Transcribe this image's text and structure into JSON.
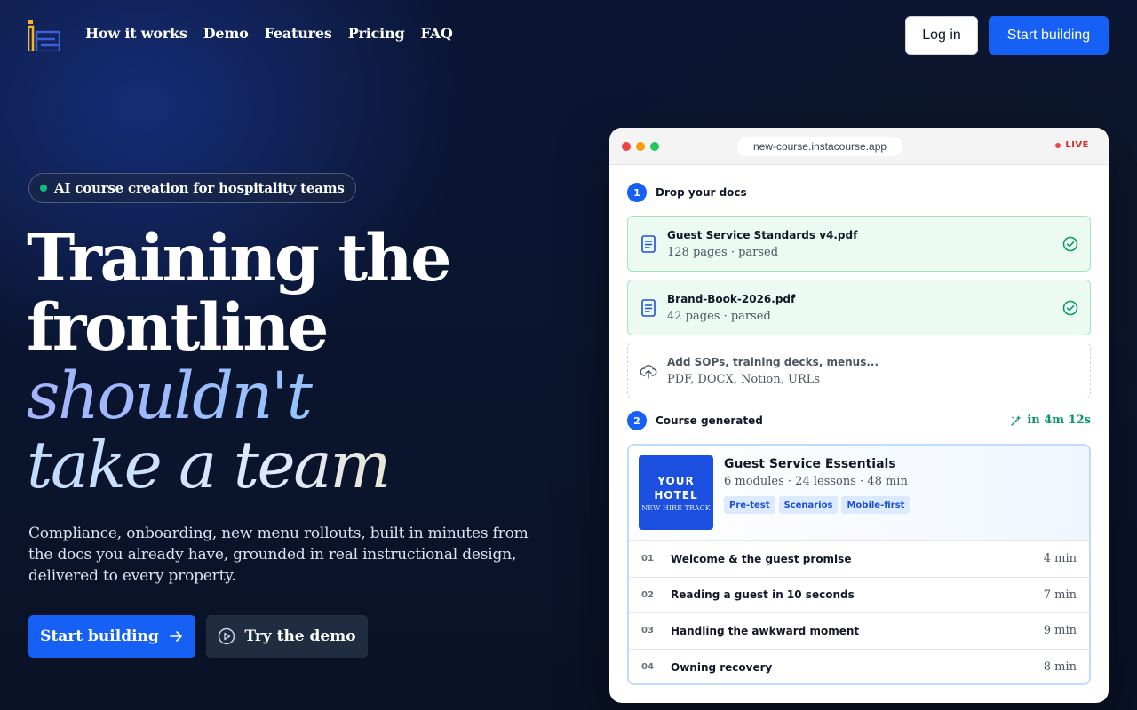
{
  "nav": {
    "logo_icon": "instacourse-logo-icon",
    "links": [
      "How it works",
      "Demo",
      "Features",
      "Pricing",
      "FAQ"
    ],
    "login_label": "Log in",
    "start_label": "Start building"
  },
  "hero": {
    "pill": "AI course creation for hospitality teams",
    "headline": {
      "line1": "Training the",
      "line2": "frontline",
      "line3": "shouldn't",
      "line4": "take a team"
    },
    "subcopy": "Compliance, onboarding, new menu rollouts, built in minutes from the docs you already have, grounded in real instructional design, delivered to every property.",
    "cta_primary": "Start building",
    "cta_secondary": "Try the demo"
  },
  "demo": {
    "url": "new-course.instacourse.app",
    "live": "LIVE",
    "step1": {
      "num": "1",
      "label": "Drop your docs"
    },
    "files": [
      {
        "title": "Guest Service Standards v4.pdf",
        "meta": "128 pages · parsed"
      },
      {
        "title": "Brand-Book-2026.pdf",
        "meta": "42 pages · parsed"
      }
    ],
    "upload": {
      "title": "Add SOPs, training decks, menus...",
      "meta": "PDF, DOCX, Notion, URLs"
    },
    "step2": {
      "num": "2",
      "label": "Course generated"
    },
    "timer": "in 4m 12s",
    "course": {
      "thumb_line1": "YOUR",
      "thumb_line2": "HOTEL",
      "thumb_line3": "NEW HIRE TRACK",
      "title": "Guest Service Essentials",
      "meta": "6 modules · 24 lessons · 48 min",
      "tags": [
        "Pre-test",
        "Scenarios",
        "Mobile-first"
      ],
      "lessons": [
        {
          "num": "01",
          "title": "Welcome & the guest promise",
          "time": "4 min"
        },
        {
          "num": "02",
          "title": "Reading a guest in 10 seconds",
          "time": "7 min"
        },
        {
          "num": "03",
          "title": "Handling the awkward moment",
          "time": "9 min"
        },
        {
          "num": "04",
          "title": "Owning recovery",
          "time": "8 min"
        }
      ]
    }
  },
  "colors": {
    "accent": "#1660f5",
    "live": "#dc2626",
    "success": "#059669"
  }
}
